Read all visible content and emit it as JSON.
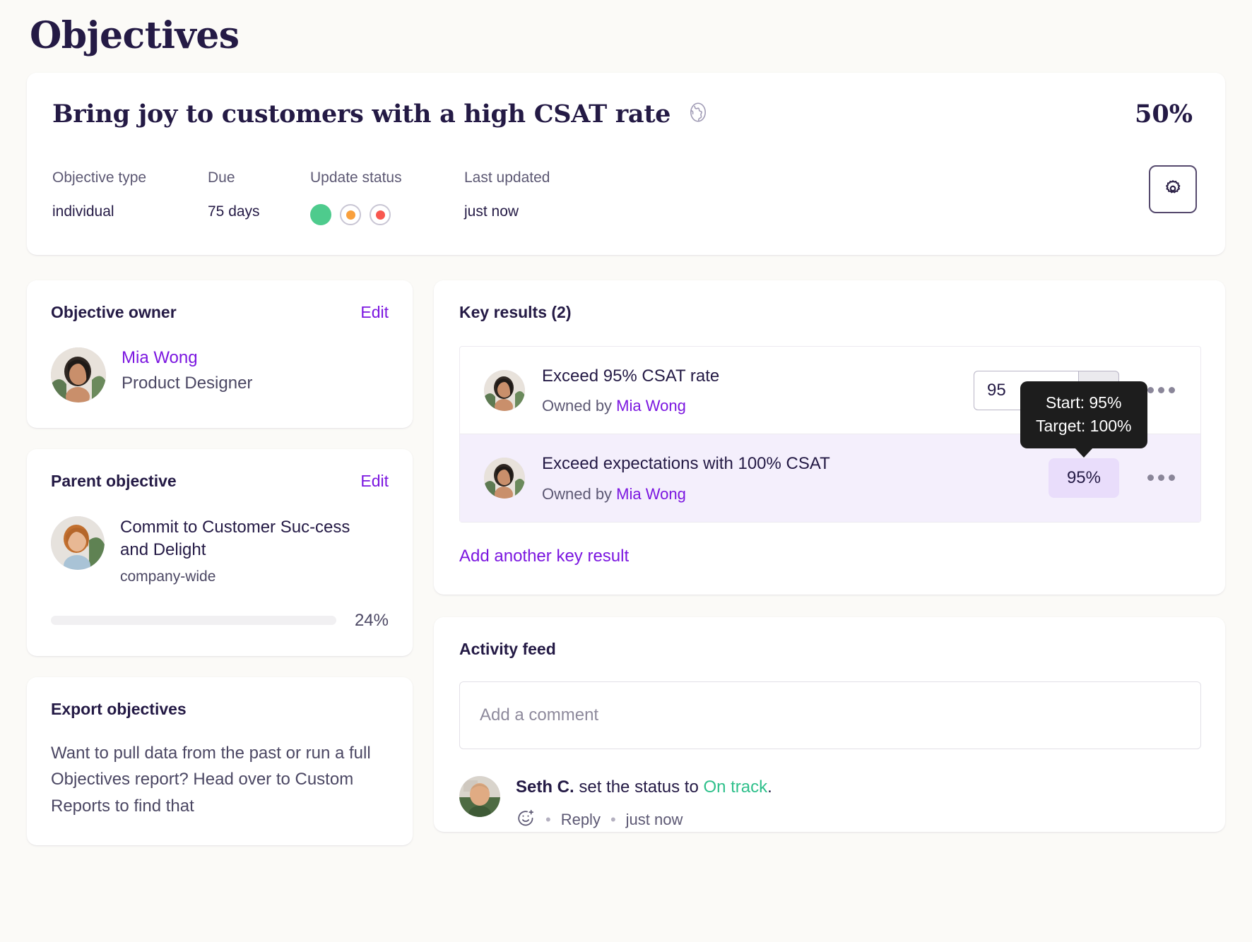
{
  "page": {
    "title": "Objectives"
  },
  "objective": {
    "name": "Bring joy to customers with a high CSAT rate",
    "visibility_icon": "globe-icon",
    "progress_percent": "50%",
    "meta": {
      "type_label": "Objective type",
      "type_value": "individual",
      "due_label": "Due",
      "due_value": "75 days",
      "update_status_label": "Update status",
      "last_updated_label": "Last updated",
      "last_updated_value": "just now",
      "status_options": [
        {
          "name": "on-track",
          "color": "#4ecb8d",
          "selected": true
        },
        {
          "name": "at-risk",
          "color": "#f9a03c",
          "selected": false
        },
        {
          "name": "off-track",
          "color": "#f8574f",
          "selected": false
        }
      ]
    },
    "settings_icon": "gear-icon"
  },
  "owner_card": {
    "title": "Objective owner",
    "edit_label": "Edit",
    "name": "Mia Wong",
    "role": "Product Designer"
  },
  "parent_card": {
    "title": "Parent objective",
    "edit_label": "Edit",
    "objective_name": "Commit to Customer Suc-cess and Delight",
    "objective_type": "company-wide",
    "progress_percent": "24%",
    "progress_value": 24,
    "progress_color": "#f8574f"
  },
  "export_card": {
    "title": "Export objectives",
    "body": "Want to pull data from the past or run a full Objectives report? Head over to Custom Reports to find that"
  },
  "key_results": {
    "title": "Key results (2)",
    "add_link": "Add another key result",
    "items": [
      {
        "name": "Exceed 95% CSAT rate",
        "owned_by_prefix": "Owned by ",
        "owner": "Mia Wong",
        "input_value": "95",
        "unit": "%",
        "control": "input",
        "highlighted": false,
        "menu_icon": "ellipsis-icon"
      },
      {
        "name": "Exceed expectations with 100% CSAT",
        "owned_by_prefix": "Owned by ",
        "owner": "Mia Wong",
        "badge_value": "95%",
        "control": "badge",
        "highlighted": true,
        "menu_icon": "ellipsis-icon"
      }
    ],
    "tooltip": {
      "line1": "Start: 95%",
      "line2": "Target: 100%"
    }
  },
  "activity_feed": {
    "title": "Activity feed",
    "comment_placeholder": "Add a comment",
    "items": [
      {
        "author": "Seth C.",
        "text_middle": " set the status to ",
        "status": "On track",
        "text_end": ".",
        "reaction_icon": "add-reaction-icon",
        "reply_label": "Reply",
        "timestamp": "just now"
      }
    ]
  }
}
